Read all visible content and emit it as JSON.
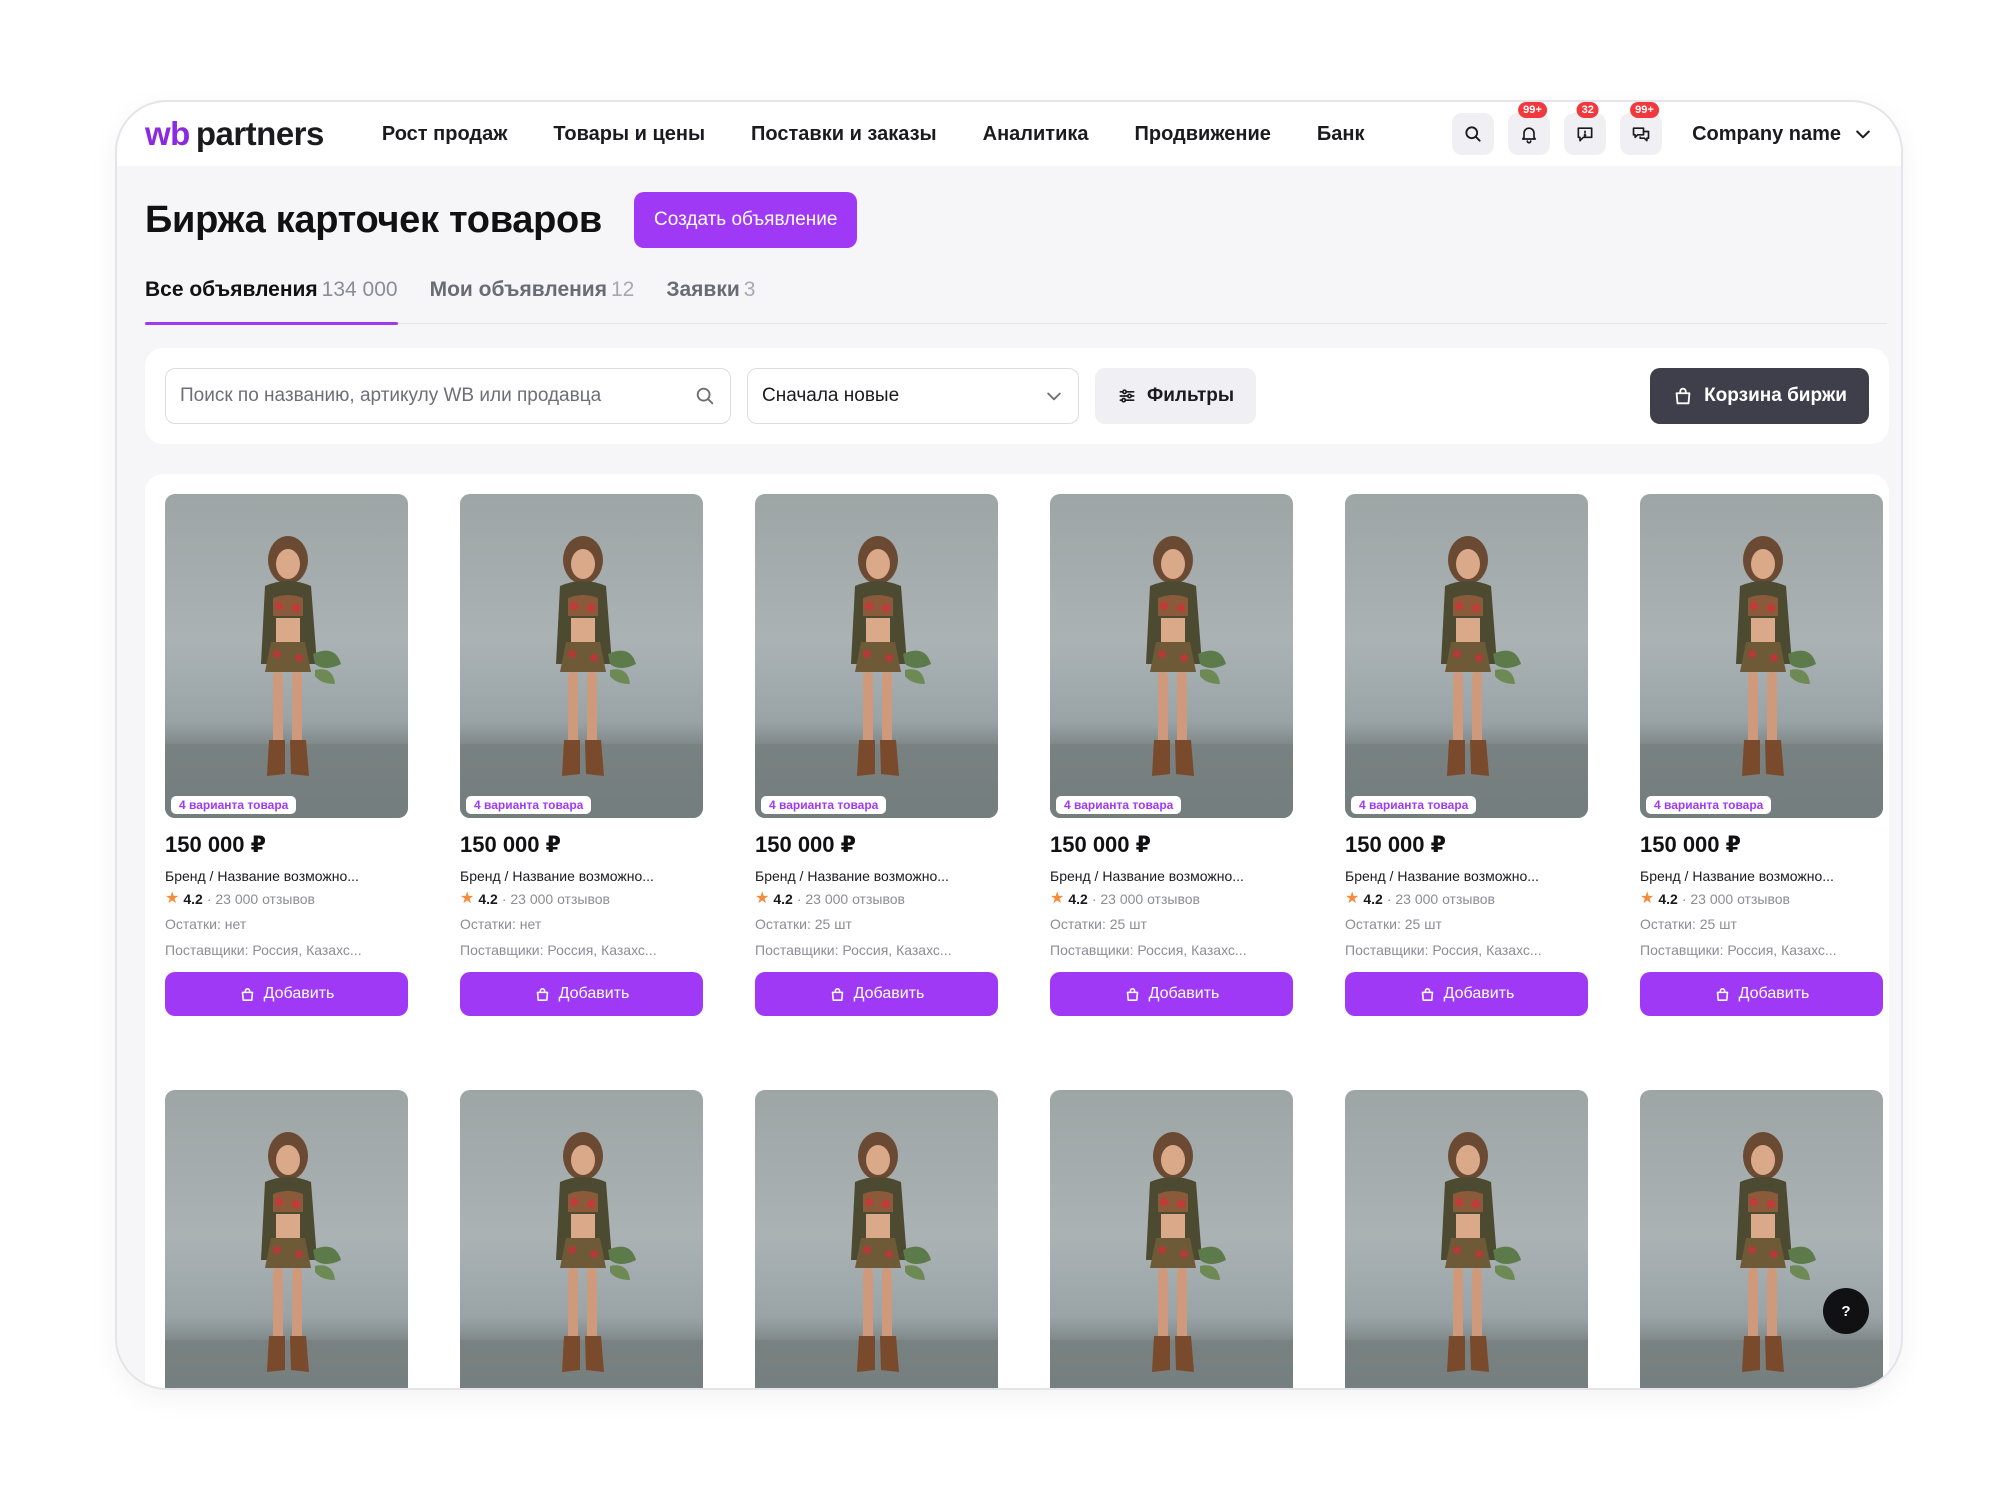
{
  "header": {
    "logo_wb": "wb",
    "logo_partners": "partners",
    "nav": [
      "Рост продаж",
      "Товары и цены",
      "Поставки и заказы",
      "Аналитика",
      "Продвижение",
      "Банк"
    ],
    "icons": [
      {
        "name": "search-icon",
        "badge": ""
      },
      {
        "name": "bell-icon",
        "badge": "99+"
      },
      {
        "name": "feedback-icon",
        "badge": "32"
      },
      {
        "name": "chat-icon",
        "badge": "99+"
      }
    ],
    "company": "Company name"
  },
  "page": {
    "title": "Биржа карточек товаров",
    "create_button": "Создать объявление"
  },
  "tabs": [
    {
      "label": "Все объявления",
      "count": "134 000",
      "active": true
    },
    {
      "label": "Мои объявления",
      "count": "12",
      "active": false
    },
    {
      "label": "Заявки",
      "count": "3",
      "active": false
    }
  ],
  "toolbar": {
    "search_placeholder": "Поиск по названию, артикулу WB или продавца",
    "sort_value": "Сначала новые",
    "filters_label": "Фильтры",
    "cart_label": "Корзина биржи"
  },
  "products": [
    {
      "variants": "4 варианта товара",
      "price": "150 000 ₽",
      "name": "Бренд / Название возможно...",
      "rating": "4.2",
      "reviews": "· 23 000 отзывов",
      "stock": "Остатки: нет",
      "suppliers": "Поставщики: Россия, Казахс...",
      "add": "Добавить"
    },
    {
      "variants": "4 варианта товара",
      "price": "150 000 ₽",
      "name": "Бренд / Название возможно...",
      "rating": "4.2",
      "reviews": "· 23 000 отзывов",
      "stock": "Остатки: нет",
      "suppliers": "Поставщики: Россия, Казахс...",
      "add": "Добавить"
    },
    {
      "variants": "4 варианта товара",
      "price": "150 000 ₽",
      "name": "Бренд / Название возможно...",
      "rating": "4.2",
      "reviews": "· 23 000 отзывов",
      "stock": "Остатки: 25 шт",
      "suppliers": "Поставщики: Россия, Казахс...",
      "add": "Добавить"
    },
    {
      "variants": "4 варианта товара",
      "price": "150 000 ₽",
      "name": "Бренд / Название возможно...",
      "rating": "4.2",
      "reviews": "· 23 000 отзывов",
      "stock": "Остатки: 25 шт",
      "suppliers": "Поставщики: Россия, Казахс...",
      "add": "Добавить"
    },
    {
      "variants": "4 варианта товара",
      "price": "150 000 ₽",
      "name": "Бренд / Название возможно...",
      "rating": "4.2",
      "reviews": "· 23 000 отзывов",
      "stock": "Остатки: 25 шт",
      "suppliers": "Поставщики: Россия, Казахс...",
      "add": "Добавить"
    },
    {
      "variants": "4 варианта товара",
      "price": "150 000 ₽",
      "name": "Бренд / Название возможно...",
      "rating": "4.2",
      "reviews": "· 23 000 отзывов",
      "stock": "Остатки: 25 шт",
      "suppliers": "Поставщики: Россия, Казахс...",
      "add": "Добавить"
    }
  ],
  "help_label": "?",
  "colors": {
    "accent": "#a039f5",
    "dark_button": "#3f3f4b",
    "badge": "#f0383d",
    "star": "#f58b3c"
  }
}
